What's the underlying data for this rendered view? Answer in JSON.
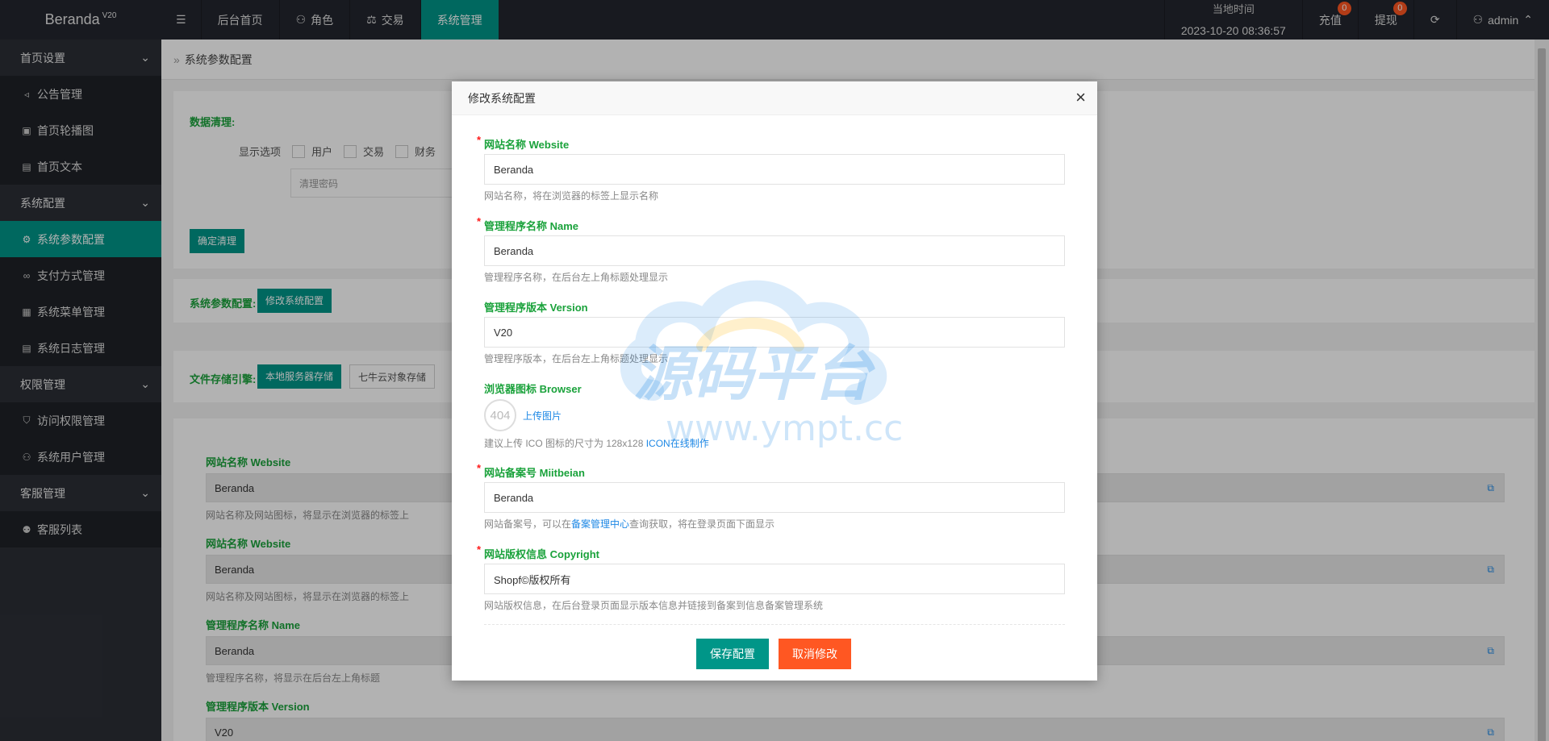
{
  "topbar": {
    "logo": "Beranda",
    "logo_version": "V20",
    "nav": [
      {
        "label": "后台首页"
      },
      {
        "label": "角色"
      },
      {
        "label": "交易"
      },
      {
        "label": "系统管理"
      }
    ],
    "clock_label": "当地时间",
    "clock_value": "2023-10-20 08:36:57",
    "recharge": "充值",
    "recharge_count": "0",
    "withdraw": "提现",
    "withdraw_count": "0",
    "user": "admin"
  },
  "sidebar": {
    "groups": [
      {
        "label": "首页设置",
        "items": [
          "公告管理",
          "首页轮播图",
          "首页文本"
        ]
      },
      {
        "label": "系统配置",
        "items": [
          "系统参数配置",
          "支付方式管理",
          "系统菜单管理",
          "系统日志管理"
        ]
      },
      {
        "label": "权限管理",
        "items": [
          "访问权限管理",
          "系统用户管理"
        ]
      },
      {
        "label": "客服管理",
        "items": [
          "客服列表"
        ]
      }
    ]
  },
  "main": {
    "breadcrumb": "系统参数配置",
    "data_clean": {
      "title": "数据清理:",
      "show_options": "显示选项",
      "opt_user": "用户",
      "opt_trade": "交易",
      "opt_finance": "财务",
      "password_placeholder": "清理密码",
      "confirm_button": "确定清理"
    },
    "sys_params": {
      "title": "系统参数配置:",
      "button": "修改系统配置"
    },
    "storage": {
      "title": "文件存储引擎:",
      "local": "本地服务器存储",
      "qiniu": "七牛云对象存储"
    },
    "fields": [
      {
        "title": "网站名称 Website",
        "value": "Beranda",
        "hint": "网站名称及网站图标，将显示在浏览器的标签上"
      },
      {
        "title": "网站名称 Website",
        "value": "Beranda",
        "hint": "网站名称及网站图标，将显示在浏览器的标签上"
      },
      {
        "title": "管理程序名称 Name",
        "value": "Beranda",
        "hint": "管理程序名称，将显示在后台左上角标题"
      },
      {
        "title": "管理程序版本 Version",
        "value": "V20"
      }
    ]
  },
  "modal": {
    "title": "修改系统配置",
    "f1_title": "网站名称 Website",
    "f1_value": "Beranda",
    "f1_hint": "网站名称，将在浏览器的标签上显示名称",
    "f2_title": "管理程序名称 Name",
    "f2_value": "Beranda",
    "f2_hint": "管理程序名称，在后台左上角标题处理显示",
    "f3_title": "管理程序版本 Version",
    "f3_value": "V20",
    "f3_hint": "管理程序版本，在后台左上角标题处理显示",
    "f4_title": "浏览器图标 Browser",
    "f4_img": "404",
    "f4_upload": "上传图片",
    "f4_hint": "建议上传 ICO 图标的尺寸为 128x128 ",
    "f4_link": "ICON在线制作",
    "f5_title": "网站备案号 Miitbeian",
    "f5_value": "Beranda",
    "f5_hint_a": "网站备案号，可以在",
    "f5_link": "备案管理中心",
    "f5_hint_b": "查询获取，将在登录页面下面显示",
    "f6_title": "网站版权信息 Copyright",
    "f6_value": "Shopf©版权所有",
    "f6_hint": "网站版权信息，在后台登录页面显示版本信息并链接到备案到信息备案管理系统",
    "save": "保存配置",
    "cancel": "取消修改"
  },
  "watermark": {
    "text": "源码平台",
    "url": "www.ympt.cc"
  },
  "colors": {
    "accent": "#009688",
    "danger": "#ff5722",
    "label_green": "#1aa23b",
    "sidebar_bg": "#2c2f36",
    "topbar_bg": "#23262e"
  }
}
